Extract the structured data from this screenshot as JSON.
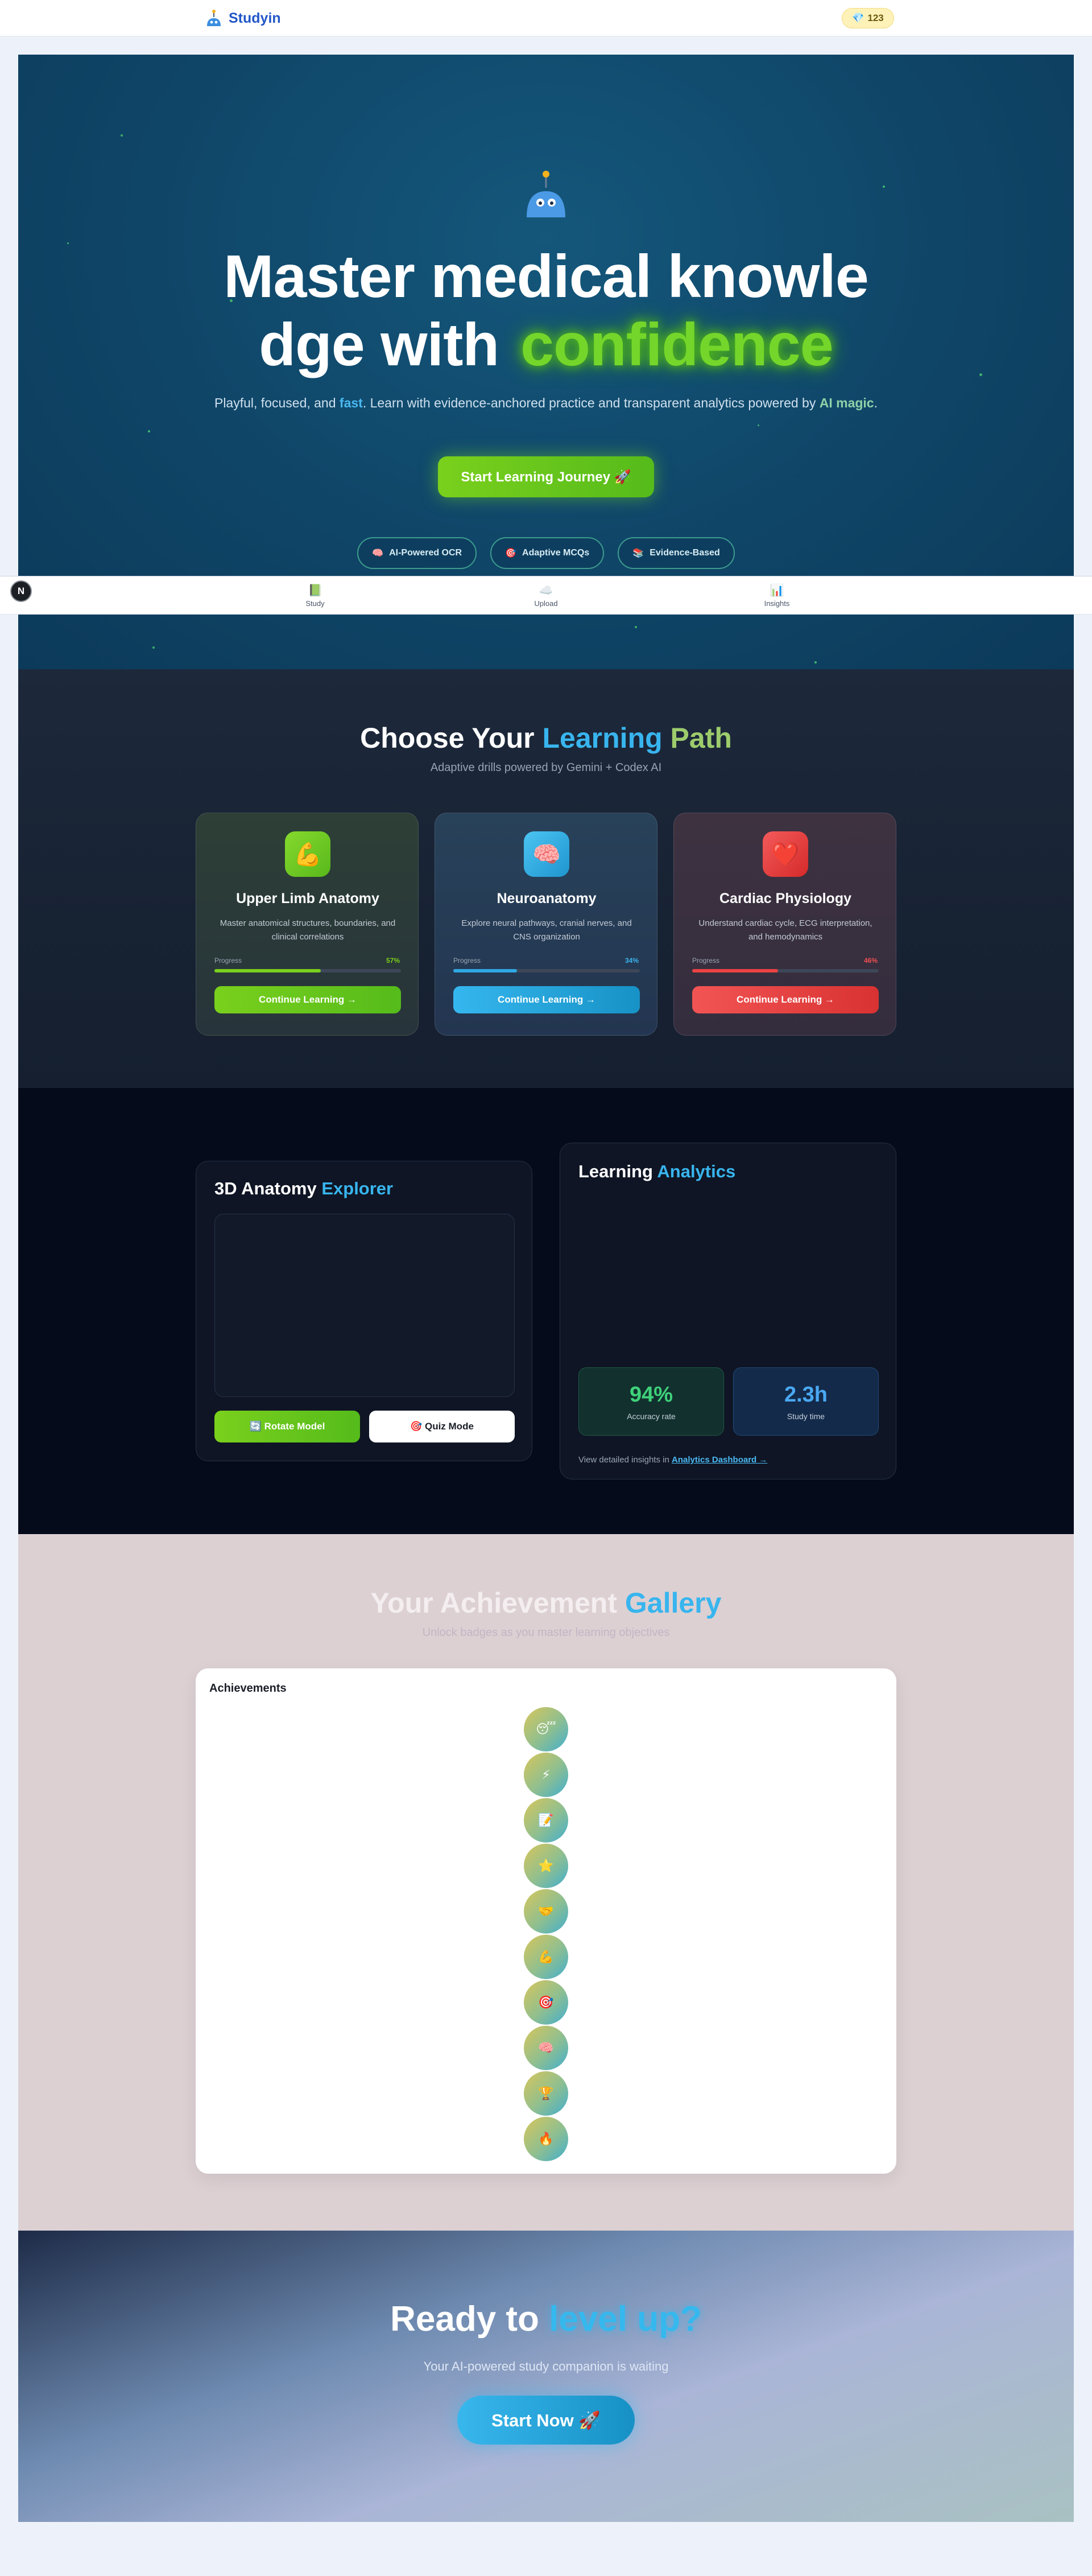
{
  "header": {
    "logo_text": "Studyin",
    "gem_icon": "gem-icon",
    "gem_count": "123"
  },
  "hero": {
    "title_line1": "Master medical knowle",
    "title_line2_pre": "dge with",
    "title_highlight": "confidence",
    "subtitle_a": "Playful, focused, and ",
    "subtitle_fast": "fast",
    "subtitle_b": ". Learn with evidence-anchored practice and transparent analytics powered by ",
    "subtitle_ai": "AI magic",
    "subtitle_c": ".",
    "cta_label": "Start Learning Journey 🚀",
    "pills": [
      {
        "icon": "🧠",
        "label": "AI-Powered OCR"
      },
      {
        "icon": "🎯",
        "label": "Adaptive MCQs"
      },
      {
        "icon": "📚",
        "label": "Evidence-Based"
      }
    ]
  },
  "nav": {
    "avatar_letter": "N",
    "items": [
      {
        "icon": "📗",
        "label": "Study"
      },
      {
        "icon": "☁️",
        "label": "Upload"
      },
      {
        "icon": "📊",
        "label": "Insights"
      }
    ]
  },
  "paths": {
    "title_pre": "Choose Your ",
    "title_word1": "Learning",
    "title_word2": " Path",
    "subtitle": "Adaptive drills powered by Gemini + Codex AI",
    "progress_label": "Progress",
    "cards": [
      {
        "icon": "💪",
        "title": "Upper Limb Anatomy",
        "description": "Master anatomical structures, boundaries, and clinical correlations",
        "progress": "57%",
        "progress_value": 0.57,
        "button": "Continue Learning →",
        "accent": "#6cc82a"
      },
      {
        "icon": "🧠",
        "title": "Neuroanatomy",
        "description": "Explore neural pathways, cranial nerves, and CNS organization",
        "progress": "34%",
        "progress_value": 0.34,
        "button": "Continue Learning →",
        "accent": "#2eaee6"
      },
      {
        "icon": "❤️",
        "title": "Cardiac Physiology",
        "description": "Understand cardiac cycle, ECG interpretation, and hemodynamics",
        "progress": "46%",
        "progress_value": 0.46,
        "button": "Continue Learning →",
        "accent": "#ec4343"
      }
    ]
  },
  "explorer": {
    "title_pre": "3D Anatomy ",
    "title_highlight": "Explorer",
    "rotate_button": "🔄 Rotate Model",
    "quiz_button": "🎯 Quiz Mode"
  },
  "analytics": {
    "title_pre": "Learning ",
    "title_highlight": "Analytics",
    "accuracy_value": "94%",
    "accuracy_label": "Accuracy rate",
    "study_value": "2.3h",
    "study_label": "Study time",
    "link_text_pre": "View detailed insights in ",
    "link_label": "Analytics Dashboard →"
  },
  "gallery": {
    "title_pre": "Your Achievement ",
    "title_highlight": "Gallery",
    "subtitle": "Unlock badges as you master learning objectives",
    "panel_title": "Achievements",
    "badges": [
      "😴",
      "⚡",
      "📝",
      "⭐",
      "🤝",
      "💪",
      "🎯",
      "🧠",
      "🏆",
      "🔥"
    ]
  },
  "ready": {
    "title_pre": "Ready to ",
    "title_highlight": "level up?",
    "subtitle": "Your AI-powered study companion is waiting",
    "button": "Start Now 🚀"
  }
}
